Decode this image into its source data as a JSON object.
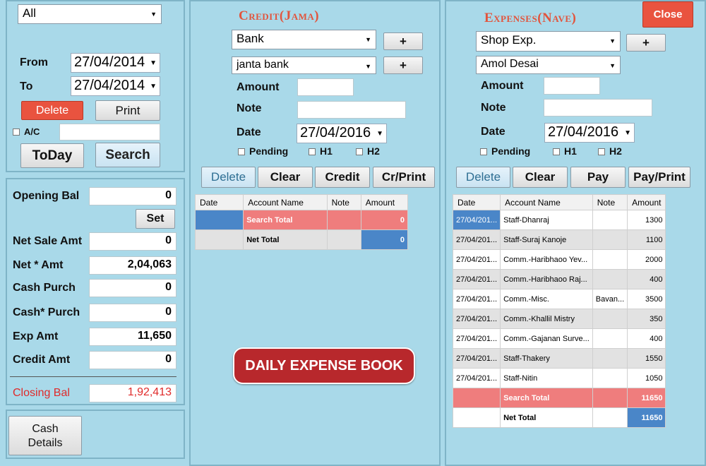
{
  "left": {
    "filter_select": "All",
    "from_label": "From",
    "from_date": "27/04/2014",
    "to_label": "To",
    "to_date": "27/04/2014",
    "delete_label": "Delete",
    "print_label": "Print",
    "ac_label": "A/C",
    "ac_value": "",
    "today_label": "ToDay",
    "search_label": "Search",
    "opening_bal_label": "Opening Bal",
    "opening_bal_value": "0",
    "set_label": "Set",
    "net_sale_label": "Net Sale Amt",
    "net_sale_value": "0",
    "net_star_label": "Net * Amt",
    "net_star_value": "2,04,063",
    "cash_purch_label": "Cash Purch",
    "cash_purch_value": "0",
    "cash_star_purch_label": "Cash* Purch",
    "cash_star_purch_value": "0",
    "exp_amt_label": "Exp Amt",
    "exp_amt_value": "11,650",
    "credit_amt_label": "Credit Amt",
    "credit_amt_value": "0",
    "closing_bal_label": "Closing Bal",
    "closing_bal_value": "1,92,413",
    "cash_details_label_1": "Cash",
    "cash_details_label_2": "Details"
  },
  "credit": {
    "title": "Credit(Jama)",
    "type_select": "Bank",
    "account_select": "janta bank",
    "plus_label": "+",
    "amount_label": "Amount",
    "amount_value": "",
    "note_label": "Note",
    "note_value": "",
    "date_label": "Date",
    "date_value": "27/04/2016",
    "pending_label": "Pending",
    "h1_label": "H1",
    "h2_label": "H2",
    "delete_label": "Delete",
    "clear_label": "Clear",
    "credit_label": "Credit",
    "crprint_label": "Cr/Print",
    "columns": [
      "Date",
      "Account Name",
      "Note",
      "Amount"
    ],
    "search_total_label": "Search Total",
    "search_total_value": "0",
    "net_total_label": "Net Total",
    "net_total_value": "0"
  },
  "expenses": {
    "title": "Expenses(Nave)",
    "close_label": "Close",
    "type_select": "Shop Exp.",
    "person_select": "Amol Desai",
    "plus_label": "+",
    "amount_label": "Amount",
    "amount_value": "",
    "note_label": "Note",
    "note_value": "",
    "date_label": "Date",
    "date_value": "27/04/2016",
    "pending_label": "Pending",
    "h1_label": "H1",
    "h2_label": "H2",
    "delete_label": "Delete",
    "clear_label": "Clear",
    "pay_label": "Pay",
    "payprint_label": "Pay/Print",
    "columns": [
      "Date",
      "Account Name",
      "Note",
      "Amount"
    ],
    "rows": [
      {
        "date": "27/04/201...",
        "account": "Staff-Dhanraj",
        "note": "",
        "amount": "1300"
      },
      {
        "date": "27/04/201...",
        "account": "Staff-Suraj Kanoje",
        "note": "",
        "amount": "1100"
      },
      {
        "date": "27/04/201...",
        "account": "Comm.-Haribhaoo Yev...",
        "note": "",
        "amount": "2000"
      },
      {
        "date": "27/04/201...",
        "account": "Comm.-Haribhaoo Raj...",
        "note": "",
        "amount": "400"
      },
      {
        "date": "27/04/201...",
        "account": "Comm.-Misc.",
        "note": "Bavan...",
        "amount": "3500"
      },
      {
        "date": "27/04/201...",
        "account": "Comm.-Khallil Mistry",
        "note": "",
        "amount": "350"
      },
      {
        "date": "27/04/201...",
        "account": "Comm.-Gajanan Surve...",
        "note": "",
        "amount": "400"
      },
      {
        "date": "27/04/201...",
        "account": "Staff-Thakery",
        "note": "",
        "amount": "1550"
      },
      {
        "date": "27/04/201...",
        "account": "Staff-Nitin",
        "note": "",
        "amount": "1050"
      }
    ],
    "search_total_label": "Search Total",
    "search_total_value": "11650",
    "net_total_label": "Net Total",
    "net_total_value": "11650"
  },
  "banner": "DAILY EXPENSE BOOK",
  "colors": {
    "accent_red": "#e2543c",
    "select_blue": "#4a86c8",
    "total_pink": "#ef7d7d",
    "background": "#a9d9e9"
  }
}
